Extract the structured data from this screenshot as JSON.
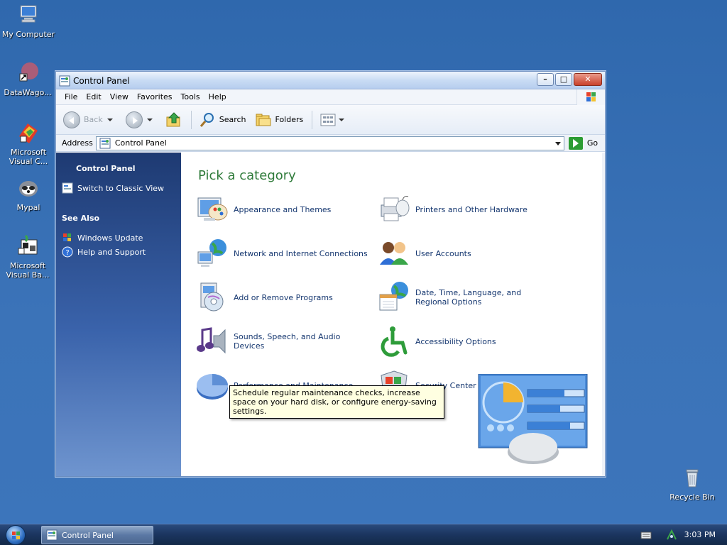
{
  "desktop": {
    "icons": [
      {
        "label": "My Computer",
        "icon": "computer-icon"
      },
      {
        "label": "DataWago...",
        "icon": "datawagon-icon"
      },
      {
        "label": "Microsoft Visual C...",
        "icon": "visual-c-icon"
      },
      {
        "label": "Mypal",
        "icon": "mypal-icon"
      },
      {
        "label": "Microsoft Visual Ba...",
        "icon": "visual-basic-icon"
      },
      {
        "label": "Recycle Bin",
        "icon": "recycle-bin-icon"
      }
    ]
  },
  "window": {
    "title": "Control Panel",
    "menu": [
      "File",
      "Edit",
      "View",
      "Favorites",
      "Tools",
      "Help"
    ],
    "toolbar": {
      "back": "Back",
      "search": "Search",
      "folders": "Folders"
    },
    "address": {
      "label": "Address",
      "value": "Control Panel",
      "go": "Go"
    },
    "taskpane": {
      "heading": "Control Panel",
      "switch_view": "Switch to Classic View",
      "see_also": "See Also",
      "links": [
        "Windows Update",
        "Help and Support"
      ]
    },
    "main": {
      "title": "Pick a category",
      "categories": [
        {
          "label": "Appearance and Themes",
          "icon": "appearance-icon"
        },
        {
          "label": "Printers and Other Hardware",
          "icon": "printer-icon"
        },
        {
          "label": "Network and Internet Connections",
          "icon": "network-icon"
        },
        {
          "label": "User Accounts",
          "icon": "user-accounts-icon"
        },
        {
          "label": "Add or Remove Programs",
          "icon": "add-remove-icon"
        },
        {
          "label": "Date, Time, Language, and Regional Options",
          "icon": "date-time-icon"
        },
        {
          "label": "Sounds, Speech, and Audio Devices",
          "icon": "sound-icon"
        },
        {
          "label": "Accessibility Options",
          "icon": "accessibility-icon"
        },
        {
          "label": "Performance and Maintenance",
          "icon": "performance-icon"
        },
        {
          "label": "Security Center",
          "icon": "security-icon"
        }
      ],
      "tooltip": "Schedule regular maintenance checks, increase space on your hard disk, or configure energy-saving settings."
    }
  },
  "taskbar": {
    "task": "Control Panel",
    "clock": "3:03 PM"
  },
  "colors": {
    "desktop": "#3b73b8",
    "title_green": "#2f7b3a",
    "link_blue": "#14366f",
    "taskpane_top": "#1e3a72"
  }
}
